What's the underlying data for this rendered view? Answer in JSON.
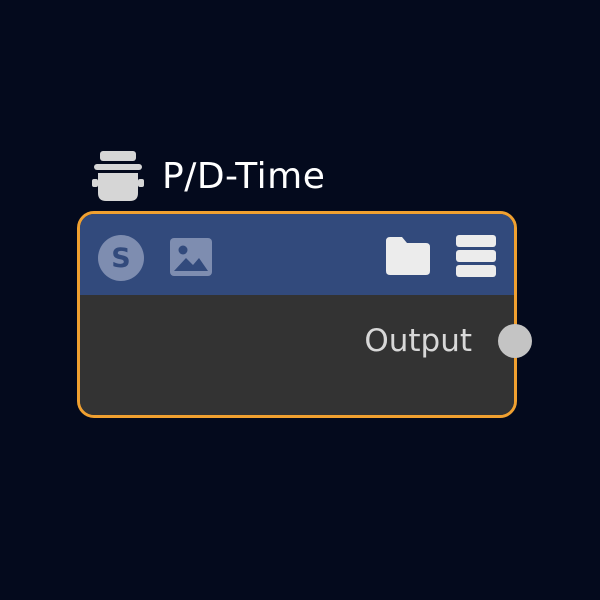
{
  "node": {
    "title": "P/D-Time",
    "title_icon": "bucket-icon",
    "header_icons": [
      "s-circle-icon",
      "image-icon",
      "folder-icon",
      "menu-icon"
    ],
    "output_label": "Output",
    "colors": {
      "background": "#040a1d",
      "border": "#f0a030",
      "header": "#324a7c",
      "body": "#333333",
      "port": "#c4c4c4"
    }
  }
}
